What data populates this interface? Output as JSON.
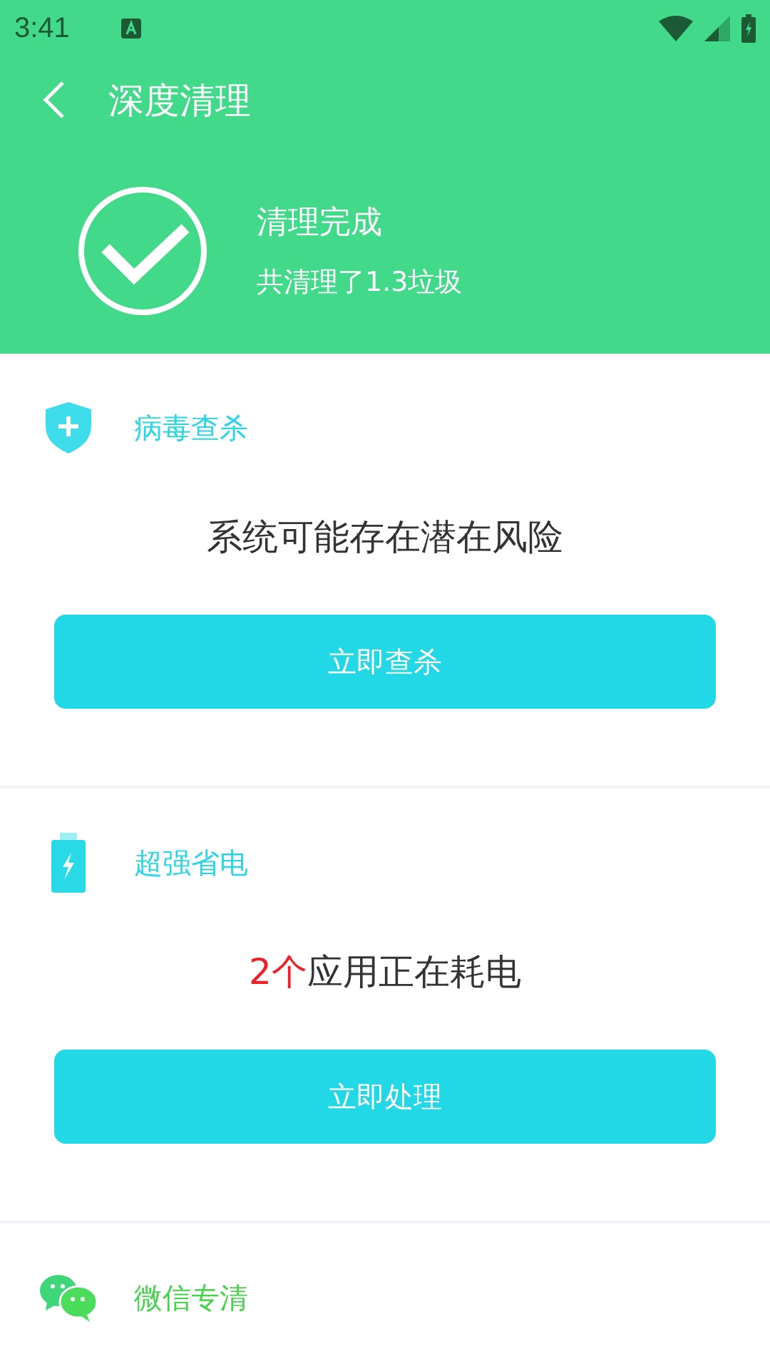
{
  "status_bar": {
    "time": "3:41"
  },
  "toolbar": {
    "title": "深度清理"
  },
  "result": {
    "title": "清理完成",
    "subtitle": "共清理了1.3垃圾"
  },
  "sections": [
    {
      "kind": "shield",
      "title": "病毒查杀",
      "color": "#29d6e6",
      "message": [
        {
          "text": "系统可能存在潜在风险",
          "emphasis": false
        }
      ],
      "button": "立即查杀"
    },
    {
      "kind": "battery",
      "title": "超强省电",
      "color": "#29d6e6",
      "message": [
        {
          "text": "2个",
          "emphasis": true
        },
        {
          "text": "应用正在耗电",
          "emphasis": false
        }
      ],
      "button": "立即处理"
    },
    {
      "kind": "chat",
      "title": "微信专清",
      "color": "#44d44a"
    }
  ]
}
